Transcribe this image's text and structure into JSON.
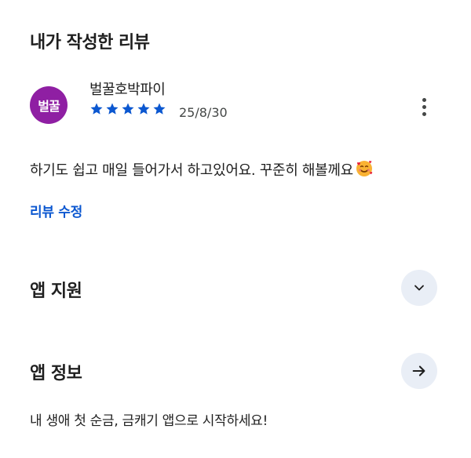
{
  "reviews_section": {
    "title": "내가 작성한 리뷰"
  },
  "review": {
    "avatar_text": "벌꿀",
    "avatar_color": "#8f1fa3",
    "reviewer_name": "벌꿀호박파이",
    "rating": 5,
    "max_rating": 5,
    "star_color": "#0b57d0",
    "date": "25/8/30",
    "text": "하기도 쉽고 매일 들어가서 하고있어요. 꾸준히 해볼께요",
    "emoji_icon": "smiling-face-with-hearts-icon",
    "edit_label": "리뷰 수정",
    "more_icon": "more-vert-icon"
  },
  "app_support": {
    "title": "앱 지원",
    "icon": "chevron-down-icon"
  },
  "app_info": {
    "title": "앱 정보",
    "icon": "arrow-right-icon",
    "description": "내 생애 첫 순금, 금캐기 앱으로 시작하세요!"
  },
  "colors": {
    "accent": "#0b57d0",
    "button_bg": "#e9eef6"
  }
}
